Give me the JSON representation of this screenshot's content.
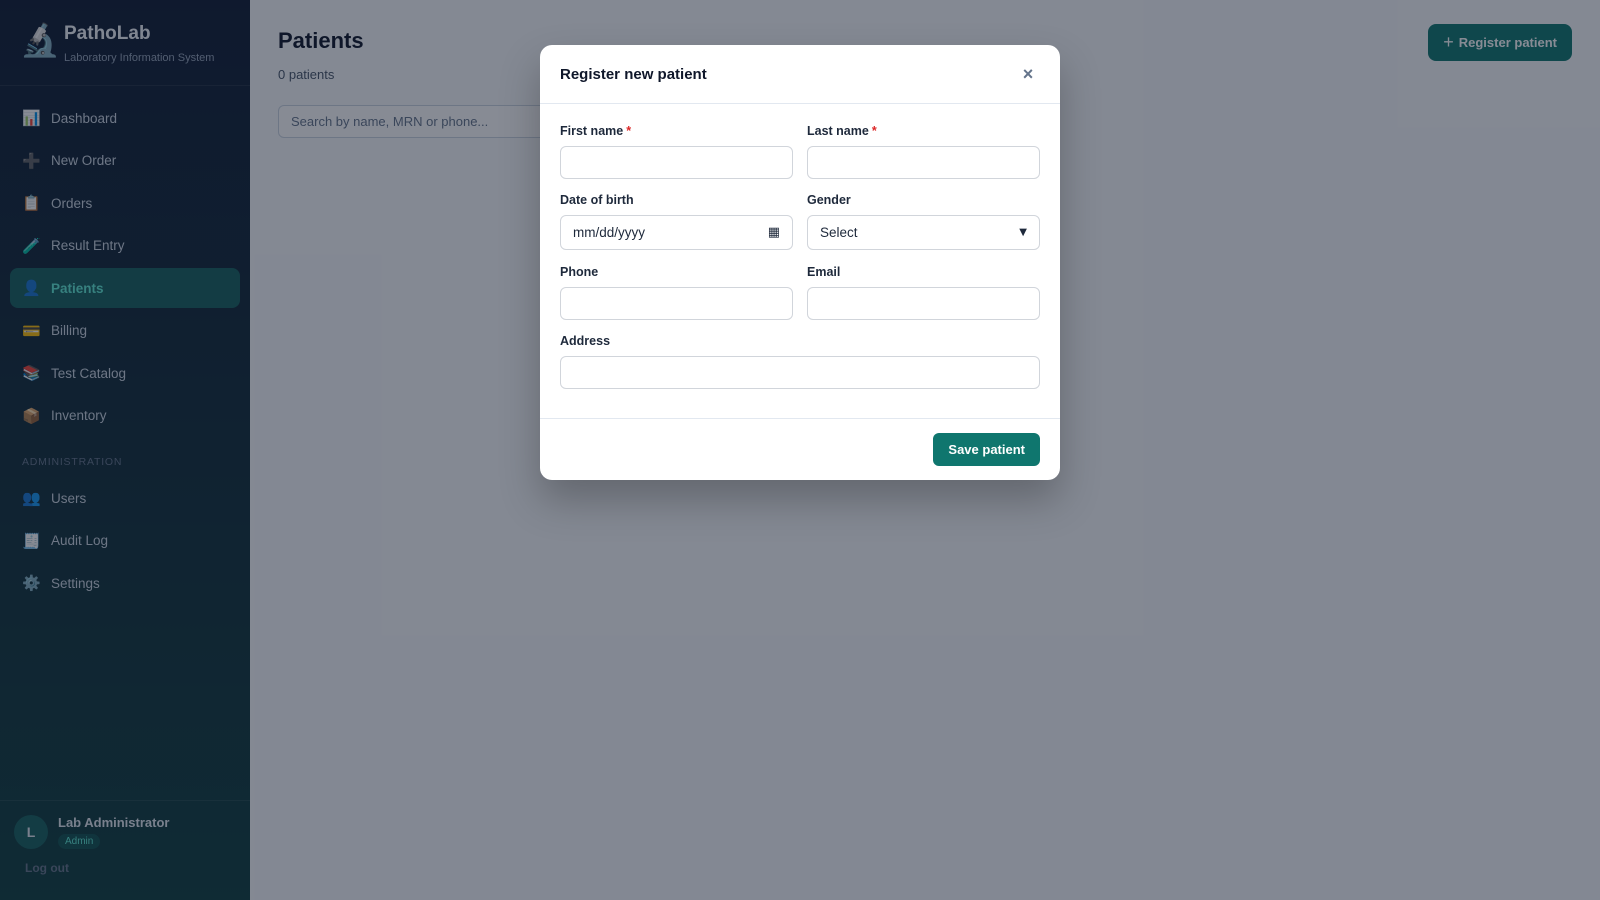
{
  "sidebar": {
    "brand": {
      "icon": "🔬",
      "name": "PathoLab",
      "subtitle": "Laboratory Information System"
    },
    "items": [
      {
        "icon": "📊",
        "label": "Dashboard"
      },
      {
        "icon": "➕",
        "label": "New Order"
      },
      {
        "icon": "📋",
        "label": "Orders"
      },
      {
        "icon": "🧪",
        "label": "Result Entry"
      },
      {
        "icon": "👤",
        "label": "Patients",
        "active": true
      },
      {
        "icon": "💳",
        "label": "Billing"
      },
      {
        "icon": "📚",
        "label": "Test Catalog"
      },
      {
        "icon": "📦",
        "label": "Inventory"
      }
    ],
    "admin_section": "ADMINISTRATION",
    "admin_items": [
      {
        "icon": "👥",
        "label": "Users"
      },
      {
        "icon": "🧾",
        "label": "Audit Log"
      },
      {
        "icon": "⚙️",
        "label": "Settings"
      }
    ],
    "user": {
      "initial": "L",
      "name": "Lab Administrator",
      "role": "Admin",
      "logout": "Log out"
    }
  },
  "main": {
    "title": "Patients",
    "count": "0 patients",
    "register_button": "Register patient",
    "search_placeholder": "Search by name, MRN or phone..."
  },
  "modal": {
    "title": "Register new patient",
    "close": "×",
    "fields": {
      "first_name": {
        "label": "First name",
        "required": "*",
        "value": ""
      },
      "last_name": {
        "label": "Last name",
        "required": "*",
        "value": ""
      },
      "dob": {
        "label": "Date of birth",
        "placeholder": "mm/dd/yyyy"
      },
      "gender": {
        "label": "Gender",
        "selected": "Select"
      },
      "phone": {
        "label": "Phone",
        "value": ""
      },
      "email": {
        "label": "Email",
        "value": ""
      },
      "address": {
        "label": "Address",
        "value": ""
      }
    },
    "save_button": "Save patient"
  },
  "colors": {
    "accent": "#0f766e",
    "sidebar_active": "#17615f",
    "required": "#dc2626"
  }
}
